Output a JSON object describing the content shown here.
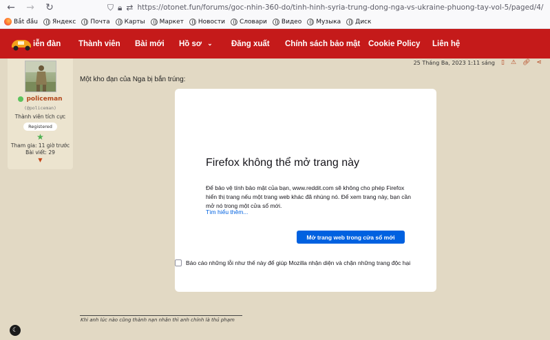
{
  "browser": {
    "url": "https://otonet.fun/forums/goc-nhin-360-do/tinh-hinh-syria-trung-dong-nga-vs-ukraine-phuong-tay-vol-5/paged/4/",
    "bookmarks": [
      "Bắt đầu",
      "Яндекс",
      "Почта",
      "Карты",
      "Маркет",
      "Новости",
      "Словари",
      "Видео",
      "Музыка",
      "Диск"
    ]
  },
  "nav": {
    "forum": "iễn đàn",
    "members": "Thành viên",
    "recent": "Bài mới",
    "profile": "Hồ sơ",
    "logout": "Đăng xuất",
    "privacy": "Chính sách bảo mật",
    "cookie": "Cookie Policy",
    "contact": "Liên hệ"
  },
  "user": {
    "name": "policeman",
    "handle": "(@policeman)",
    "title": "Thành viên tích cực",
    "badge": "Registered",
    "joined": "Tham gia: 11 giờ trước",
    "posts": "Bài viết: 29"
  },
  "post": {
    "date": "25 Tháng Ba, 2023 1:11 sáng",
    "text": "Một kho đạn của Nga bị bắn trúng:",
    "signature": "Khi anh lúc nào cũng thành nạn nhân thì anh chính là thủ phạm"
  },
  "error": {
    "title": "Firefox không thể mở trang này",
    "desc": "Để bảo vệ tính bảo mật của bạn, www.reddit.com sẽ không cho phép Firefox hiển thị trang nếu một trang web khác đã nhúng nó. Để xem trang này, bạn cần mở nó trong một cửa sổ mới.",
    "learn": "Tìm hiểu thêm...",
    "button": "Mở trang web trong cửa sổ mới",
    "report": "Báo cáo những lỗi như thế này để giúp Mozilla nhận diện và chặn những trang độc hại"
  },
  "colors": {
    "nav_bg": "#c51a1a",
    "page_bg": "#e2d9c4",
    "accent": "#0061e0"
  }
}
